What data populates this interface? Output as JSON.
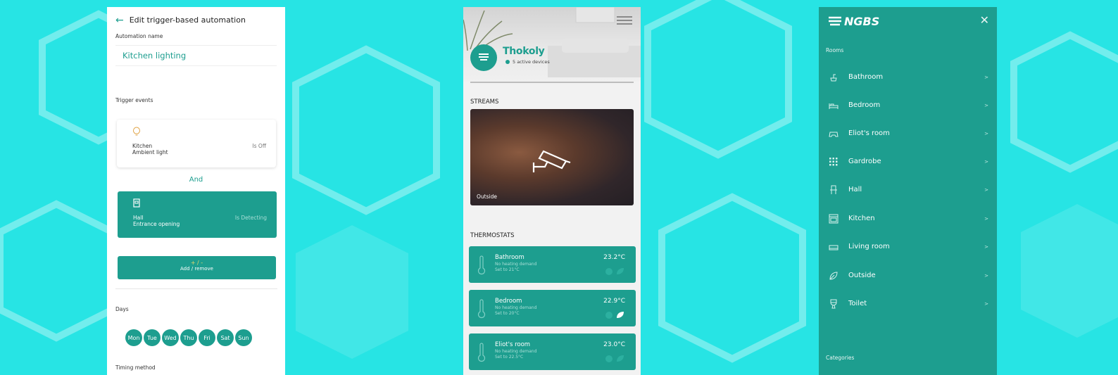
{
  "colors": {
    "teal": "#1d9e8f",
    "cyan_background": "#27e4e4",
    "white": "#ffffff",
    "accent_yellow": "#e9d96b"
  },
  "automation_panel": {
    "title": "Edit trigger-based automation",
    "automation_name_label": "Automation name",
    "automation_name_value": "Kitchen lighting",
    "trigger_events_label": "Trigger events",
    "trigger_1": {
      "icon": "bulb-icon",
      "room": "Kitchen",
      "device": "Ambient light",
      "state": "Is Off"
    },
    "conjunction": "And",
    "trigger_2": {
      "icon": "door-sensor-icon",
      "room": "Hall",
      "device": "Entrance opening",
      "state": "Is Detecting"
    },
    "add_remove_symbol": "+ / -",
    "add_remove_label": "Add / remove",
    "days_label": "Days",
    "days": [
      "Mon",
      "Tue",
      "Wed",
      "Thu",
      "Fri",
      "Sat",
      "Sun"
    ],
    "timing_method_label": "Timing method"
  },
  "home_panel": {
    "brand": "Thokoly",
    "active_devices": "5 active devices",
    "streams_heading": "STREAMS",
    "stream_caption": "Outside",
    "thermostats_heading": "THERMOSTATS",
    "thermostats": [
      {
        "name": "Bathroom",
        "status": "No heating demand",
        "setpoint": "Set to 21°C",
        "temp": "23.2°C"
      },
      {
        "name": "Bedroom",
        "status": "No heating demand",
        "setpoint": "Set to 20°C",
        "temp": "22.9°C"
      },
      {
        "name": "Eliot's room",
        "status": "No heating demand",
        "setpoint": "Set to 22.5°C",
        "temp": "23.0°C"
      }
    ]
  },
  "menu_panel": {
    "logo_text": "NGBS",
    "rooms_heading": "Rooms",
    "rooms": [
      {
        "name": "Bathroom",
        "icon": "sink-icon"
      },
      {
        "name": "Bedroom",
        "icon": "bed-icon"
      },
      {
        "name": "Eliot's room",
        "icon": "gamepad-icon"
      },
      {
        "name": "Gardrobe",
        "icon": "grid-icon"
      },
      {
        "name": "Hall",
        "icon": "chair-icon"
      },
      {
        "name": "Kitchen",
        "icon": "oven-icon"
      },
      {
        "name": "Living room",
        "icon": "sofa-icon"
      },
      {
        "name": "Outside",
        "icon": "leaf-icon"
      },
      {
        "name": "Toilet",
        "icon": "toilet-icon"
      }
    ],
    "chevron": ">",
    "categories_heading": "Categories"
  }
}
